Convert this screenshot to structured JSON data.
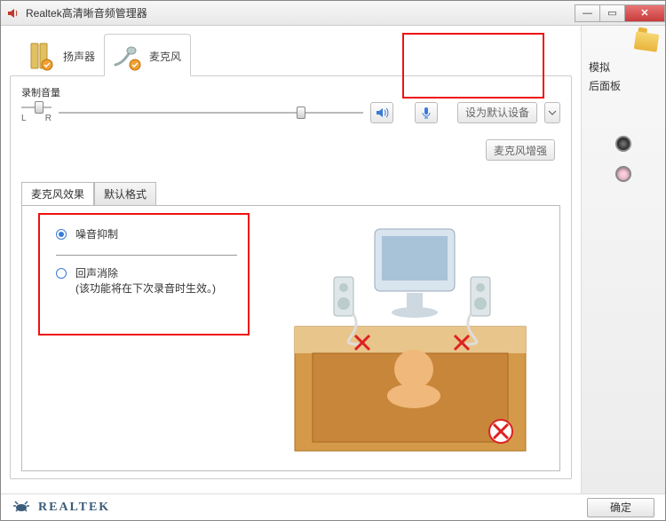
{
  "window": {
    "title": "Realtek高清晰音频管理器"
  },
  "tabs": {
    "speaker": "扬声器",
    "mic": "麦克风"
  },
  "volume": {
    "label": "录制音量",
    "left": "L",
    "right": "R",
    "balance_pos_pct": 45,
    "level_pos_pct": 78
  },
  "top_buttons": {
    "mute": "静音",
    "mic": "麦克风",
    "set_default_device": "设为默认设备",
    "mic_boost": "麦克风增强"
  },
  "subtabs": {
    "effects": "麦克风效果",
    "default_format": "默认格式"
  },
  "options": {
    "noise_suppression": "噪音抑制",
    "echo_cancel_title": "回声消除",
    "echo_cancel_note": "(该功能将在下次录音时生效。)"
  },
  "sidebar": {
    "analog_label": "模拟",
    "rear_panel": "后面板"
  },
  "footer": {
    "brand": "REALTEK",
    "ok": "确定"
  }
}
